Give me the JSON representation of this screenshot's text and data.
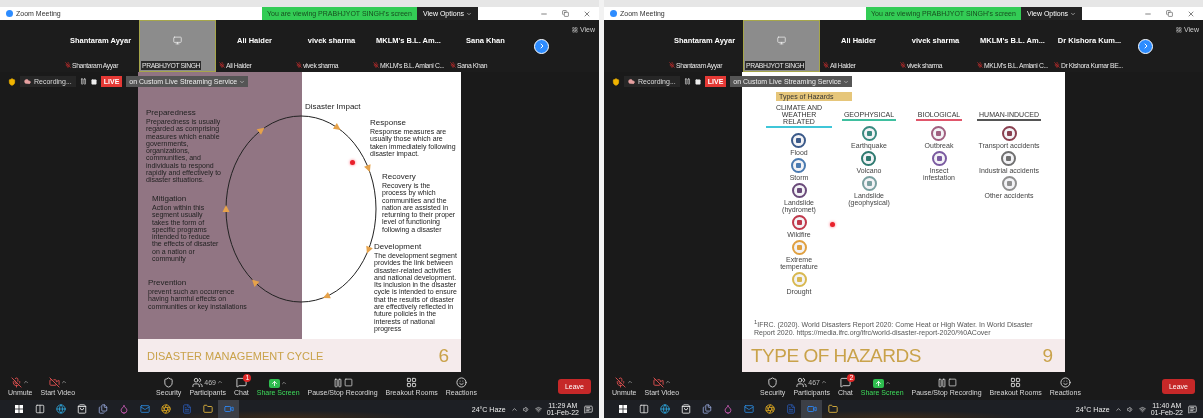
{
  "screens": [
    {
      "window_title": "Zoom Meeting",
      "banner": "You are viewing PRABHJYOT SINGH's screen",
      "view_options": "View Options",
      "view": "View",
      "tiles": [
        {
          "kind": "camera-off",
          "name": "Shantaram Ayyar",
          "label": "Shantaram Ayyar",
          "muted": true,
          "selected": false
        },
        {
          "kind": "screen",
          "label": "PRABHJYOT SINGH",
          "selected": true
        },
        {
          "kind": "camera-off",
          "name": "Ali Haider",
          "label": "Ali Haider",
          "muted": true,
          "selected": false
        },
        {
          "kind": "camera-off",
          "name": "vivek sharma",
          "label": "vivek sharma",
          "muted": true,
          "selected": false
        },
        {
          "kind": "camera-off",
          "name": "MKLM's B.L. Am...",
          "label": "MKLM's B.L. Amlani C...",
          "muted": true,
          "selected": false
        },
        {
          "kind": "camera-off",
          "name": "Sana Khan",
          "label": "Sana Khan",
          "muted": true,
          "selected": false
        }
      ],
      "recording": "Recording...",
      "live": "LIVE",
      "stream": "on Custom Live Streaming Service",
      "slide": {
        "kind": "cycle",
        "center_label": "Disaster Impact",
        "title": "DISASTER MANAGEMENT CYCLE",
        "number": "6",
        "stages": [
          {
            "title": "Preparedness",
            "text": "Preparedness is usually regarded as comprising measures which enable governments, organizations, communities, and individuals to respond rapidly and effectively to disaster situations."
          },
          {
            "title": "Response",
            "text": "Response measures are usually those which are taken immediately following disaster impact."
          },
          {
            "title": "Recovery",
            "text": "Recovery is the process by which communities and the nation are assisted in returning to their proper level of functioning following a disaster"
          },
          {
            "title": "Mitigation",
            "text": "Action within this segment usually takes the form of specific programs intended to reduce the effects of disaster on a nation or community"
          },
          {
            "title": "Development",
            "text": "The development segment provides the link between disaster-related activities and national development. Its inclusion in the disaster cycle is intended to ensure that the results of disaster are effectively reflected in future policies in the interests of national progress"
          },
          {
            "title": "Prevention",
            "text": "prevent such an occurrence having harmful effects on communities or key installations"
          }
        ]
      },
      "toolbar": [
        {
          "kind": "mic-off",
          "label": "Unmute",
          "caret": true
        },
        {
          "kind": "video-off",
          "label": "Start Video",
          "caret": true
        },
        {
          "kind": "security",
          "label": "Security",
          "caret": false
        },
        {
          "kind": "participants",
          "label": "Participants",
          "count": "469",
          "caret": true
        },
        {
          "kind": "chat",
          "label": "Chat",
          "badge": "1",
          "caret": false
        },
        {
          "kind": "share",
          "label": "Share Screen",
          "caret": true
        },
        {
          "kind": "recording",
          "label": "Pause/Stop Recording",
          "caret": false
        },
        {
          "kind": "breakout",
          "label": "Breakout Rooms",
          "caret": false
        },
        {
          "kind": "reactions",
          "label": "Reactions",
          "caret": false
        }
      ],
      "leave": "Leave",
      "apps": [
        {
          "kind": "windows",
          "selected": false
        },
        {
          "kind": "taskview",
          "selected": false
        },
        {
          "kind": "edge",
          "selected": false
        },
        {
          "kind": "store",
          "selected": false
        },
        {
          "kind": "files",
          "selected": false
        },
        {
          "kind": "paint",
          "selected": false
        },
        {
          "kind": "mail",
          "selected": false
        },
        {
          "kind": "chrome",
          "selected": false
        },
        {
          "kind": "word",
          "selected": false
        },
        {
          "kind": "explorer",
          "selected": false
        },
        {
          "kind": "zoom",
          "selected": true
        }
      ],
      "weather": "24°C  Haze",
      "time": "11:29 AM",
      "date": "01-Feb-22"
    },
    {
      "window_title": "Zoom Meeting",
      "banner": "You are viewing PRABHJYOT SINGH's screen",
      "view_options": "View Options",
      "view": "View",
      "tiles": [
        {
          "kind": "camera-off",
          "name": "Shantaram Ayyar",
          "label": "Shantaram Ayyar",
          "muted": true,
          "selected": false
        },
        {
          "kind": "screen",
          "label": "PRABHJYOT SINGH",
          "selected": true
        },
        {
          "kind": "camera-off",
          "name": "Ali Haider",
          "label": "Ali Haider",
          "muted": true,
          "selected": false
        },
        {
          "kind": "camera-off",
          "name": "vivek sharma",
          "label": "vivek sharma",
          "muted": true,
          "selected": false
        },
        {
          "kind": "camera-off",
          "name": "MKLM's B.L. Am...",
          "label": "MKLM's B.L. Amlani C...",
          "muted": true,
          "selected": false
        },
        {
          "kind": "camera-off",
          "name": "Dr Kishora Kum...",
          "label": "Dr Kishora Kumar BE...",
          "muted": true,
          "selected": false
        }
      ],
      "recording": "Recording...",
      "live": "LIVE",
      "stream": "on Custom Live Streaming Service",
      "slide": {
        "kind": "hazards",
        "tag": "Types of Hazards",
        "title": "TYPE OF HAZARDS",
        "number": "9",
        "footnote": "$^{1}$IFRC. (2020). World Disasters Report 2020: Come Heat or High Water. In World Disaster Report 2020. https://media.ifrc.org/ifrc/world-disaster-report-2020/%0ACover",
        "columns": [
          {
            "heading": "CLIMATE AND WEATHER RELATED",
            "color": "#3fc6d8",
            "items": [
              {
                "label": "Flood",
                "color": "#3b5a8a"
              },
              {
                "label": "Storm",
                "color": "#4a7ab0"
              },
              {
                "label": "Landslide (hydromet)",
                "color": "#6a4a7a"
              },
              {
                "label": "Wildfire",
                "color": "#c0394b"
              },
              {
                "label": "Extreme temperature",
                "color": "#e0a040"
              },
              {
                "label": "Drought",
                "color": "#d8b850"
              }
            ]
          },
          {
            "heading": "GEOPHYSICAL",
            "color": "#3fbf9f",
            "items": [
              {
                "label": "Earthquake",
                "color": "#3a8a80"
              },
              {
                "label": "Volcano",
                "color": "#2f7a70"
              },
              {
                "label": "Landslide (geophysical)",
                "color": "#7aa0a0"
              }
            ]
          },
          {
            "heading": "BIOLOGICAL",
            "color": "#e0566b",
            "items": [
              {
                "label": "Outbreak",
                "color": "#a06080"
              },
              {
                "label": "Insect infestation",
                "color": "#7a5aa0"
              }
            ]
          },
          {
            "heading": "HUMAN-INDUCED",
            "color": "#555555",
            "items": [
              {
                "label": "Transport accidents",
                "color": "#8a4050"
              },
              {
                "label": "Industrial accidents",
                "color": "#707070"
              },
              {
                "label": "Other accidents",
                "color": "#909090"
              }
            ]
          }
        ]
      },
      "toolbar": [
        {
          "kind": "mic-off",
          "label": "Unmute",
          "caret": true
        },
        {
          "kind": "video-off",
          "label": "Start Video",
          "caret": true
        },
        {
          "kind": "security",
          "label": "Security",
          "caret": false
        },
        {
          "kind": "participants",
          "label": "Participants",
          "count": "467",
          "caret": true
        },
        {
          "kind": "chat",
          "label": "Chat",
          "badge": "2",
          "caret": false
        },
        {
          "kind": "share",
          "label": "Share Screen",
          "caret": true
        },
        {
          "kind": "recording",
          "label": "Pause/Stop Recording",
          "caret": false
        },
        {
          "kind": "breakout",
          "label": "Breakout Rooms",
          "caret": false
        },
        {
          "kind": "reactions",
          "label": "Reactions",
          "caret": false
        }
      ],
      "leave": "Leave",
      "apps": [
        {
          "kind": "windows",
          "selected": false
        },
        {
          "kind": "taskview",
          "selected": false
        },
        {
          "kind": "edge",
          "selected": false
        },
        {
          "kind": "store",
          "selected": false
        },
        {
          "kind": "files",
          "selected": false
        },
        {
          "kind": "paint",
          "selected": false
        },
        {
          "kind": "mail",
          "selected": false
        },
        {
          "kind": "chrome",
          "selected": false
        },
        {
          "kind": "word",
          "selected": false
        },
        {
          "kind": "zoom",
          "selected": true
        },
        {
          "kind": "explorer",
          "selected": false
        }
      ],
      "weather": "24°C  Haze",
      "time": "11:40 AM",
      "date": "01-Feb-22"
    }
  ]
}
